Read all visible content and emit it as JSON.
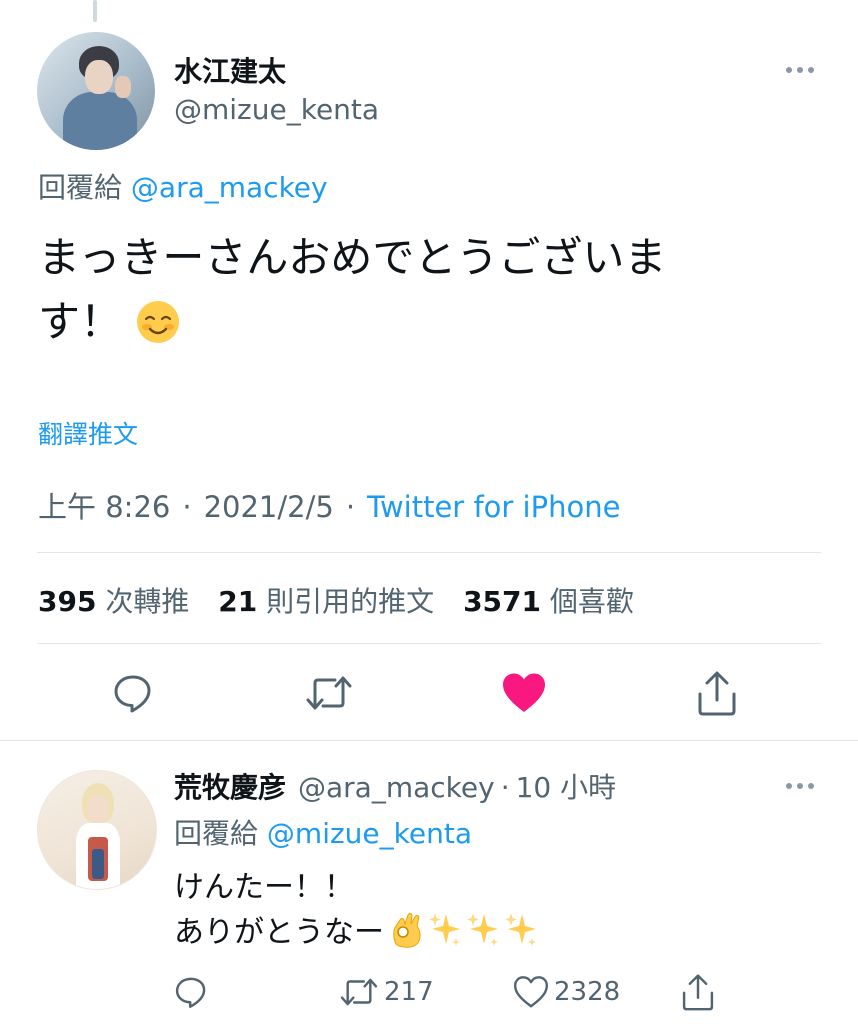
{
  "tweet": {
    "display_name": "水江建太",
    "handle": "@mizue_kenta",
    "reply_prefix": "回覆給",
    "reply_to": "@ara_mackey",
    "text_line1": "まっきーさんおめでとうございま",
    "text_line2": "す！",
    "emoji": "smiling-face-icon",
    "translate_label": "翻譯推文",
    "time": "上午 8:26",
    "dot": "·",
    "date": "2021/2/5",
    "source": "Twitter for iPhone"
  },
  "stats": {
    "retweets_count": "395",
    "retweets_label": "次轉推",
    "quotes_count": "21",
    "quotes_label": "則引用的推文",
    "likes_count": "3571",
    "likes_label": "個喜歡"
  },
  "actions": {
    "reply_icon": "reply-icon",
    "retweet_icon": "retweet-icon",
    "like_icon": "heart-filled-icon",
    "share_icon": "share-icon",
    "like_color": "#f91880"
  },
  "reply": {
    "display_name": "荒牧慶彦",
    "handle": "@ara_mackey",
    "dot": "·",
    "time": "10 小時",
    "reply_prefix": "回覆給",
    "reply_to": "@mizue_kenta",
    "text_line1": "けんたー！！",
    "text_line2": "ありがとうなー",
    "emojis": [
      "ok-hand-icon",
      "sparkles-icon",
      "sparkles-icon",
      "sparkles-icon"
    ],
    "retweet_count": "217",
    "like_count": "2328"
  },
  "colors": {
    "accent": "#1d9bf0",
    "secondary_text": "#536471",
    "primary_text": "#0f1419"
  }
}
